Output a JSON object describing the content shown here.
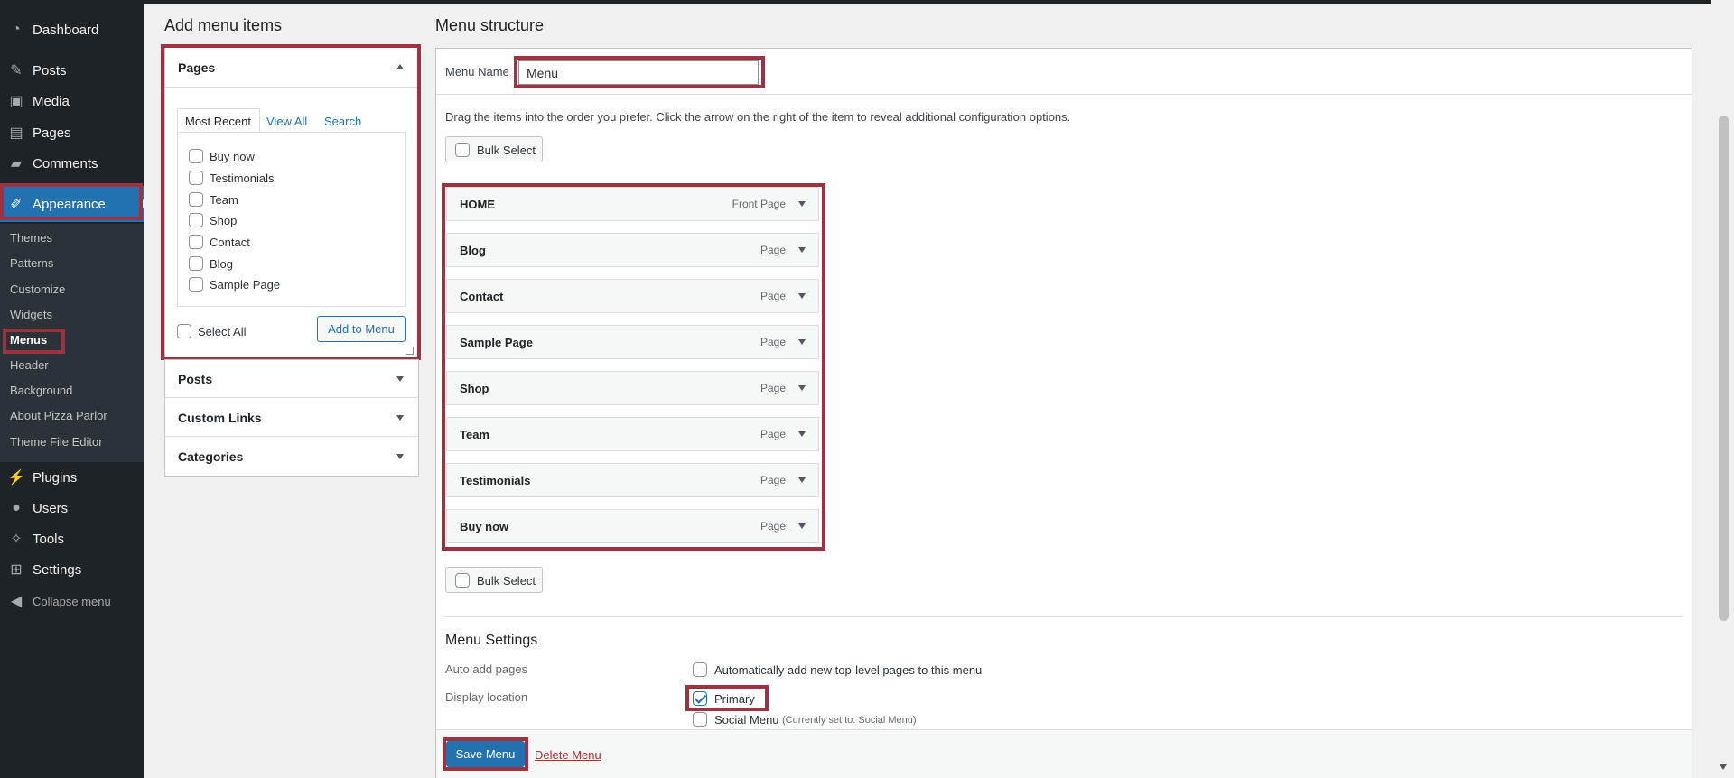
{
  "sidebar": {
    "top_items": [
      {
        "label": "Dashboard",
        "icon": "dashboard-icon"
      },
      {
        "label": "Posts",
        "icon": "pin-icon"
      },
      {
        "label": "Media",
        "icon": "media-icon"
      },
      {
        "label": "Pages",
        "icon": "pages-icon"
      },
      {
        "label": "Comments",
        "icon": "comment-icon"
      }
    ],
    "active": {
      "label": "Appearance",
      "icon": "brush-icon"
    },
    "submenu": [
      "Themes",
      "Patterns",
      "Customize",
      "Widgets",
      "Menus",
      "Header",
      "Background",
      "About Pizza Parlor",
      "Theme File Editor"
    ],
    "bottom_items": [
      {
        "label": "Plugins",
        "icon": "plug-icon"
      },
      {
        "label": "Users",
        "icon": "user-icon"
      },
      {
        "label": "Tools",
        "icon": "wrench-icon"
      },
      {
        "label": "Settings",
        "icon": "settings-icon"
      }
    ],
    "collapse_label": "Collapse menu"
  },
  "left": {
    "heading": "Add menu items",
    "pages_panel": {
      "title": "Pages",
      "tabs": [
        "Most Recent",
        "View All",
        "Search"
      ],
      "pages": [
        "Buy now",
        "Testimonials",
        "Team",
        "Shop",
        "Contact",
        "Blog",
        "Sample Page"
      ],
      "select_all": "Select All",
      "add_button": "Add to Menu"
    },
    "other_panels": [
      "Posts",
      "Custom Links",
      "Categories"
    ]
  },
  "right": {
    "heading": "Menu structure",
    "menu_name_label": "Menu Name",
    "menu_name_value": "Menu",
    "instructions": "Drag the items into the order you prefer. Click the arrow on the right of the item to reveal additional configuration options.",
    "bulk_select": "Bulk Select",
    "items": [
      {
        "title": "HOME",
        "type": "Front Page"
      },
      {
        "title": "Blog",
        "type": "Page"
      },
      {
        "title": "Contact",
        "type": "Page"
      },
      {
        "title": "Sample Page",
        "type": "Page"
      },
      {
        "title": "Shop",
        "type": "Page"
      },
      {
        "title": "Team",
        "type": "Page"
      },
      {
        "title": "Testimonials",
        "type": "Page"
      },
      {
        "title": "Buy now",
        "type": "Page"
      }
    ],
    "settings": {
      "heading": "Menu Settings",
      "auto_add_label": "Auto add pages",
      "auto_add_option": "Automatically add new top-level pages to this menu",
      "display_location_label": "Display location",
      "primary": "Primary",
      "social_menu": "Social Menu",
      "social_note": "(Currently set to: Social Menu)"
    },
    "save_button": "Save Menu",
    "delete_link": "Delete Menu"
  }
}
